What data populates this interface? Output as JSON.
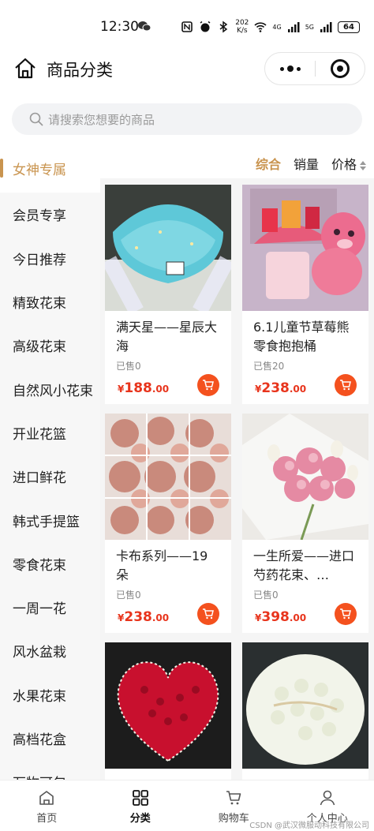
{
  "status_bar": {
    "time": "12:30",
    "speed": "202\nK/s",
    "signal1": "4G",
    "signal2": "5G",
    "battery": "64"
  },
  "header": {
    "title": "商品分类"
  },
  "search": {
    "placeholder": "请搜索您想要的商品"
  },
  "sidebar": {
    "items": [
      {
        "label": "女神专属",
        "active": true
      },
      {
        "label": "会员专享"
      },
      {
        "label": "今日推荐"
      },
      {
        "label": "精致花束"
      },
      {
        "label": "高级花束"
      },
      {
        "label": "自然风小花束"
      },
      {
        "label": "开业花篮"
      },
      {
        "label": "进口鲜花"
      },
      {
        "label": "韩式手提篮"
      },
      {
        "label": "零食花束"
      },
      {
        "label": "一周一花"
      },
      {
        "label": "风水盆栽"
      },
      {
        "label": "水果花束"
      },
      {
        "label": "高档花盒"
      },
      {
        "label": "万物可包"
      }
    ]
  },
  "sort": {
    "comprehensive": "综合",
    "sales": "销量",
    "price": "价格"
  },
  "products": [
    {
      "name": "满天星——星辰大海",
      "sold": "已售0",
      "currency": "¥",
      "price_int": "188",
      "price_dec": ".00",
      "image": "blue-baby-breath-bouquet"
    },
    {
      "name": "6.1儿童节草莓熊零食抱抱桶",
      "sold": "已售20",
      "currency": "¥",
      "price_int": "238",
      "price_dec": ".00",
      "image": "strawberry-bear-snack-bucket"
    },
    {
      "name": "卡布系列——19朵",
      "sold": "已售0",
      "currency": "¥",
      "price_int": "238",
      "price_dec": ".00",
      "image": "cappuccino-roses-grid"
    },
    {
      "name": "一生所爱——进口芍药花束、…",
      "sold": "已售0",
      "currency": "¥",
      "price_int": "398",
      "price_dec": ".00",
      "image": "pink-peony-bouquet"
    },
    {
      "name": "",
      "sold": "",
      "currency": "",
      "price_int": "",
      "price_dec": "",
      "image": "red-rose-heart"
    },
    {
      "name": "",
      "sold": "",
      "currency": "",
      "price_int": "",
      "price_dec": "",
      "image": "white-rose-bouquet"
    }
  ],
  "tabbar": {
    "home": "首页",
    "category": "分类",
    "cart": "购物车",
    "profile": "个人中心"
  },
  "watermark": "CSDN @武汉微服动科技有限公司"
}
